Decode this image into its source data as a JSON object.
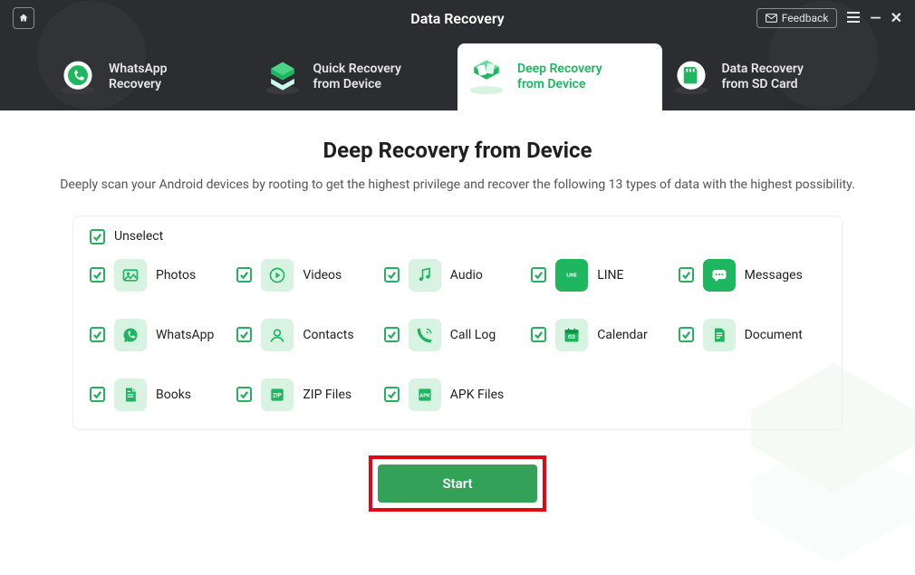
{
  "header": {
    "title": "Data Recovery",
    "feedback_label": "Feedback"
  },
  "tabs": [
    {
      "line1": "WhatsApp",
      "line2": "Recovery",
      "name": "whatsapp-recovery"
    },
    {
      "line1": "Quick Recovery",
      "line2": "from Device",
      "name": "quick-recovery"
    },
    {
      "line1": "Deep Recovery",
      "line2": "from Device",
      "name": "deep-recovery",
      "active": true
    },
    {
      "line1": "Data Recovery",
      "line2": "from SD Card",
      "name": "sd-card-recovery"
    }
  ],
  "page": {
    "title": "Deep Recovery from Device",
    "subtitle": "Deeply scan your Android devices by rooting to get the highest privilege and recover the following 13 types of data with the highest possibility."
  },
  "unselect_label": "Unselect",
  "items": [
    {
      "label": "Photos",
      "icon": "photo-icon"
    },
    {
      "label": "Videos",
      "icon": "video-icon"
    },
    {
      "label": "Audio",
      "icon": "audio-icon"
    },
    {
      "label": "LINE",
      "icon": "line-icon",
      "dark": true
    },
    {
      "label": "Messages",
      "icon": "message-icon",
      "dark": true
    },
    {
      "label": "WhatsApp",
      "icon": "whatsapp-icon"
    },
    {
      "label": "Contacts",
      "icon": "contacts-icon"
    },
    {
      "label": "Call Log",
      "icon": "calllog-icon"
    },
    {
      "label": "Calendar",
      "icon": "calendar-icon"
    },
    {
      "label": "Document",
      "icon": "document-icon"
    },
    {
      "label": "Books",
      "icon": "books-icon"
    },
    {
      "label": "ZIP Files",
      "icon": "zip-icon"
    },
    {
      "label": "APK Files",
      "icon": "apk-icon"
    }
  ],
  "start_label": "Start",
  "colors": {
    "accent": "#1eb75f",
    "accent_dark": "#34a158",
    "highlight_red": "#e40613"
  }
}
